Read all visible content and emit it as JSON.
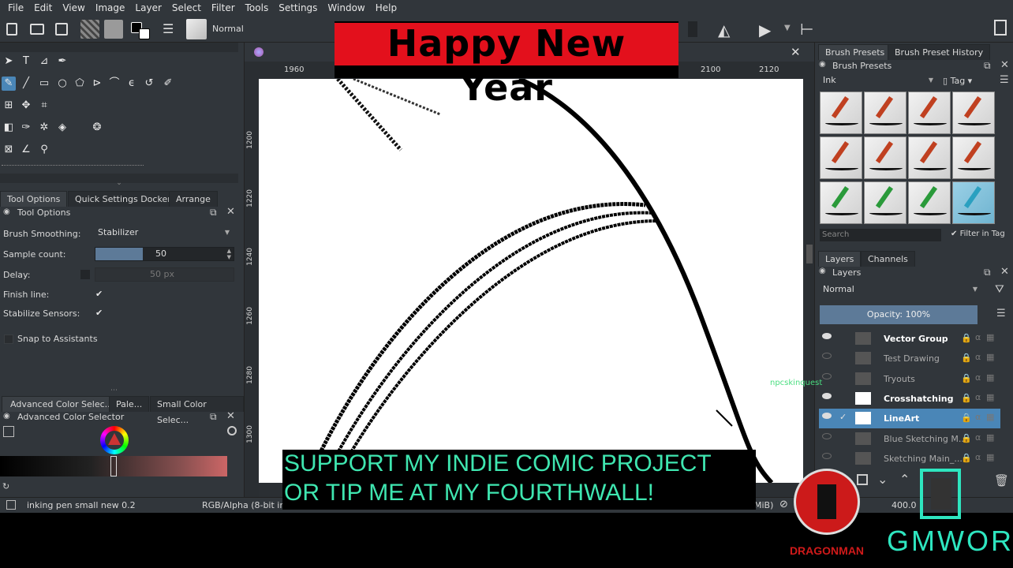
{
  "menu": [
    "File",
    "Edit",
    "View",
    "Image",
    "Layer",
    "Select",
    "Filter",
    "Tools",
    "Settings",
    "Window",
    "Help"
  ],
  "toolbar": {
    "blend_mode": "Normal"
  },
  "overlay": {
    "banner": "Happy New Year",
    "support_line1": "SUPPORT MY INDIE COMIC PROJECT",
    "support_line2": "OR TIP ME AT MY FOURTHWALL!",
    "logo_left": "DRAGONMAN",
    "logo_right": "GMWOR",
    "watermark": "npcskinquest"
  },
  "ruler": {
    "top": [
      "1960",
      "2100",
      "2120"
    ],
    "left": [
      "1200",
      "1220",
      "1240",
      "1260",
      "1280",
      "1300"
    ]
  },
  "left_tabs": [
    "Tool Options",
    "Quick Settings Docker",
    "Arrange"
  ],
  "tool_options": {
    "title": "Tool Options",
    "brush_smoothing_label": "Brush Smoothing:",
    "brush_smoothing_value": "Stabilizer",
    "sample_count_label": "Sample count:",
    "sample_count_value": "50",
    "delay_label": "Delay:",
    "delay_value": "50 px",
    "finish_line_label": "Finish line:",
    "stabilize_sensors_label": "Stabilize Sensors:",
    "snap_label": "Snap to Assistants"
  },
  "color_tabs": [
    "Advanced Color Selec...",
    "Pale...",
    "Small Color Selec..."
  ],
  "color_panel_title": "Advanced Color Selector",
  "right_tabs_top": [
    "Brush Presets",
    "Brush Preset History"
  ],
  "brush_presets": {
    "title": "Brush Presets",
    "filter": "Ink",
    "tag": "Tag",
    "search_placeholder": "Search",
    "filter_in_tag": "Filter in Tag"
  },
  "right_tabs_mid": [
    "Layers",
    "Channels"
  ],
  "layers": {
    "title": "Layers",
    "blend": "Normal",
    "opacity": "Opacity:  100%",
    "items": [
      {
        "name": "Vector Group",
        "bold": true
      },
      {
        "name": "Test Drawing",
        "bold": false
      },
      {
        "name": "Tryouts",
        "bold": false
      },
      {
        "name": "Crosshatching",
        "bold": true
      },
      {
        "name": "LineArt",
        "bold": true
      },
      {
        "name": "Blue Sketching M...",
        "bold": false
      },
      {
        "name": "Sketching Main_...",
        "bold": false
      }
    ]
  },
  "status": {
    "brush_name": "inking pen small new 0.2",
    "color_mode": "RGB/Alpha (8-bit inte",
    "mem": "MiB)",
    "zoom": "400.0"
  }
}
